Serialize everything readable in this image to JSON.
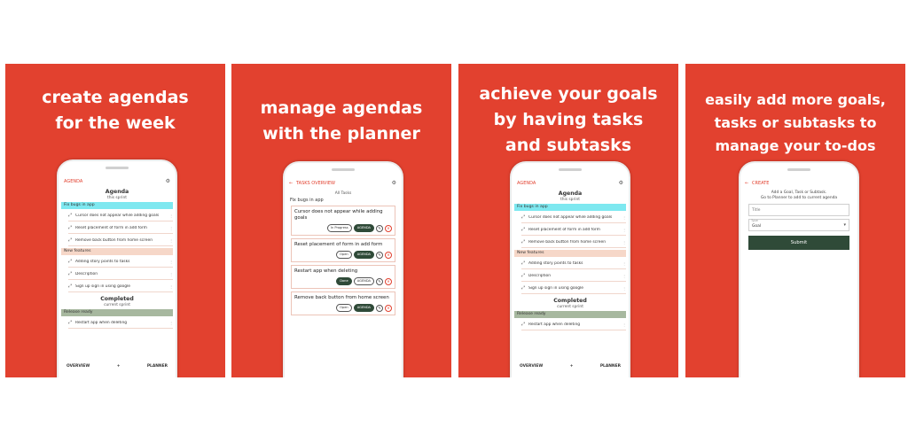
{
  "colors": {
    "panel_bg": "#e2412f",
    "accent_dark": "#2f4a38",
    "section_bug": "#7ee8f0",
    "section_feature": "#f6d7c8",
    "section_released": "#a7b89f"
  },
  "panels": [
    {
      "headline": [
        "create agendas",
        "for the week"
      ],
      "screen": {
        "topbar_title": "AGENDA",
        "title": "Agenda",
        "subtitle": "this sprint",
        "sections": [
          {
            "label": "Fix bugs in app",
            "tasks": [
              "Cursor does not appear while adding goals",
              "Reset placement of form in add form",
              "Remove back button from home screen"
            ]
          },
          {
            "label": "New features",
            "tasks": [
              "Adding story points to tasks",
              "Description",
              "Sign up sign in using google"
            ]
          }
        ],
        "completed_title": "Completed",
        "completed_sub": "current sprint",
        "completed_section": "Release ready",
        "completed_tasks": [
          "Restart app when deleting"
        ],
        "bottom_left": "OVERVIEW",
        "bottom_mid": "+",
        "bottom_right": "PLANNER"
      }
    },
    {
      "headline": [
        "manage agendas",
        "with the planner"
      ],
      "screen": {
        "topbar_title": "TASKS OVERVIEW",
        "filter": "All Tasks",
        "group": "Fix bugs in app",
        "cards": [
          {
            "title": "Cursor does not appear while adding goals",
            "status": "In Progress",
            "action": "AGENDA"
          },
          {
            "title": "Reset placement of form in add form",
            "status": "Open",
            "action": "AGENDA"
          },
          {
            "title": "Restart app when deleting",
            "status": "Done",
            "action": "AGENDA"
          },
          {
            "title": "Remove back button from home screen",
            "status": "Open",
            "action": "AGENDA"
          }
        ]
      }
    },
    {
      "headline": [
        "achieve your goals",
        "by having tasks",
        "and subtasks"
      ],
      "screen": {
        "topbar_title": "AGENDA",
        "title": "Agenda",
        "subtitle": "this sprint",
        "sections": [
          {
            "label": "Fix bugs in app",
            "tasks": [
              "Cursor does not appear while adding goals",
              "Reset placement of form in add form",
              "Remove back button from home screen"
            ]
          },
          {
            "label": "New features",
            "tasks": [
              "Adding story points to tasks",
              "Description",
              "Sign up sign in using google"
            ]
          }
        ],
        "completed_title": "Completed",
        "completed_sub": "current sprint",
        "completed_section": "Release ready",
        "completed_tasks": [
          "Restart app when deleting"
        ],
        "bottom_left": "OVERVIEW",
        "bottom_mid": "+",
        "bottom_right": "PLANNER"
      }
    },
    {
      "headline": [
        "easily add more goals,",
        "tasks or subtasks to",
        "manage your to-dos"
      ],
      "screen": {
        "topbar_title": "CREATE",
        "note": [
          "Add a Goal, Task or Subtask.",
          "Go to Planner to add to current agenda"
        ],
        "title_placeholder": "Title",
        "type_label": "Type",
        "type_value": "Goal",
        "submit": "Submit"
      }
    }
  ]
}
